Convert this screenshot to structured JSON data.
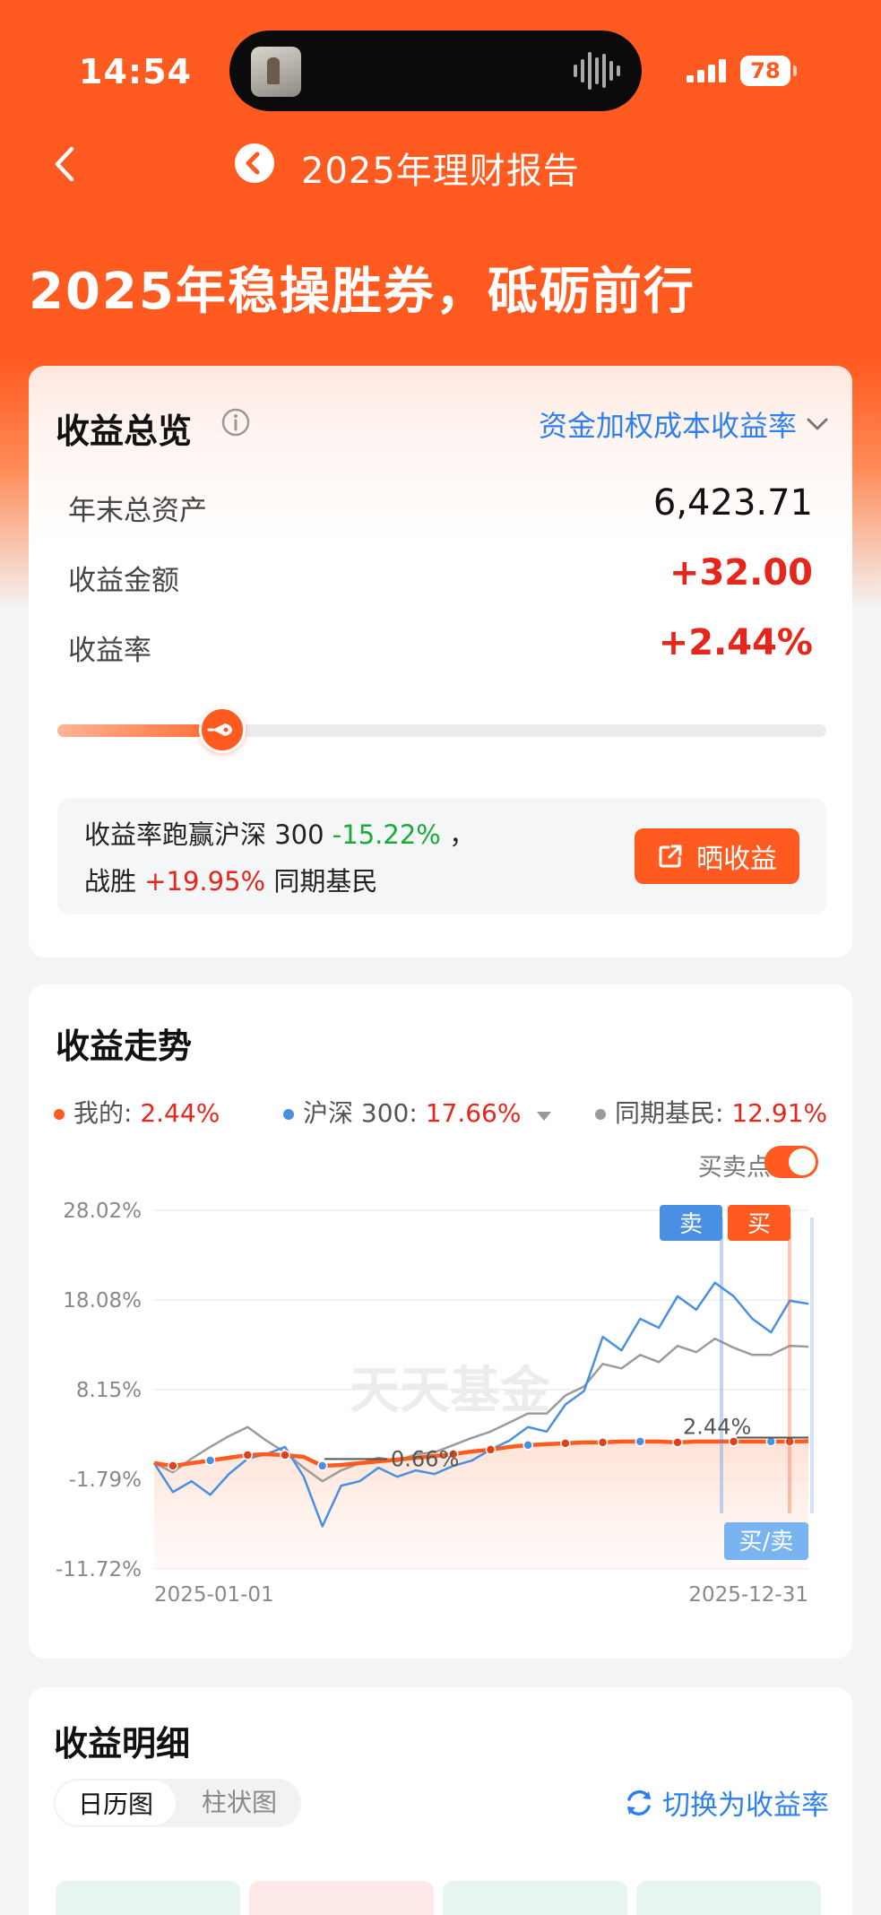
{
  "status": {
    "time": "14:54",
    "battery": "78"
  },
  "nav": {
    "title": "2025年理财报告"
  },
  "headline": "2025年稳操胜券，砥砺前行",
  "overview": {
    "title": "收益总览",
    "mode": "资金加权成本收益率",
    "rows": [
      {
        "label": "年末总资产",
        "value": "6,423.71"
      },
      {
        "label": "收益金额",
        "value": "+32.00"
      },
      {
        "label": "收益率",
        "value": "+2.44%"
      }
    ],
    "progress": 0.215,
    "compare": {
      "line1_prefix": "收益率跑赢沪深 300",
      "line1_value": "-15.22%",
      "line1_suffix": "，",
      "line2_prefix": "战胜",
      "line2_value": "+19.95%",
      "line2_suffix": "同期基民"
    },
    "share_label": "晒收益"
  },
  "trend": {
    "title": "收益走势",
    "legend": {
      "mine_label": "我的:",
      "mine_value": "2.44%",
      "hs300_label": "沪深 300:",
      "hs300_value": "17.66%",
      "peers_label": "同期基民:",
      "peers_value": "12.91%"
    },
    "buy_sell_label": "买卖点:",
    "watermark": "天天基金",
    "sell_tag": "卖",
    "buy_tag": "买",
    "buy_sell_tag": "买/卖",
    "end_label": "2.44%",
    "mid_label": "0.66%"
  },
  "colors": {
    "accent": "#ff5a1f",
    "mine": "#ff5a1f",
    "hs300": "#4a90e2",
    "peers": "#9b9b9b",
    "up": "#e6251b",
    "down": "#1aaa37"
  },
  "chart_data": {
    "type": "line",
    "x_start": "2025-01-01",
    "x_end": "2025-12-31",
    "yticks": [
      "28.02%",
      "18.08%",
      "8.15%",
      "-1.79%",
      "-11.72%"
    ],
    "ylim": [
      -11.72,
      28.02
    ],
    "series": [
      {
        "name": "我的",
        "values": [
          0.0,
          -0.3,
          0.0,
          0.3,
          0.6,
          0.9,
          1.0,
          0.9,
          0.7,
          -0.3,
          -0.2,
          0.0,
          0.2,
          0.4,
          0.6,
          0.8,
          1.0,
          1.3,
          1.5,
          1.8,
          2.0,
          2.1,
          2.2,
          2.3,
          2.3,
          2.4,
          2.4,
          2.4,
          2.3,
          2.4,
          2.4,
          2.4,
          2.4,
          2.4,
          2.4,
          2.44
        ]
      },
      {
        "name": "沪深 300",
        "values": [
          0.0,
          -3.2,
          -2.0,
          -3.5,
          -1.2,
          0.5,
          1.0,
          1.8,
          -1.5,
          -7.0,
          -2.5,
          -2.0,
          -0.5,
          -1.5,
          -0.8,
          -1.2,
          -0.3,
          0.3,
          1.5,
          2.5,
          4.0,
          3.5,
          6.5,
          8.0,
          14.0,
          12.5,
          16.0,
          15.0,
          18.5,
          17.0,
          20.0,
          18.5,
          16.0,
          14.5,
          18.0,
          17.66
        ]
      },
      {
        "name": "同期基民",
        "values": [
          0.0,
          -1.0,
          0.5,
          1.8,
          3.0,
          4.0,
          2.5,
          1.2,
          -0.5,
          -2.0,
          -0.8,
          0.0,
          0.6,
          0.2,
          1.0,
          1.2,
          2.0,
          2.8,
          3.5,
          4.5,
          5.5,
          5.5,
          7.5,
          8.5,
          11.0,
          10.5,
          12.0,
          11.2,
          13.0,
          12.3,
          13.8,
          12.8,
          12.0,
          12.0,
          13.0,
          12.91
        ]
      }
    ]
  },
  "detail": {
    "title": "收益明细",
    "tabs": [
      "日历图",
      "柱状图"
    ],
    "switch_label": "切换为收益率"
  }
}
